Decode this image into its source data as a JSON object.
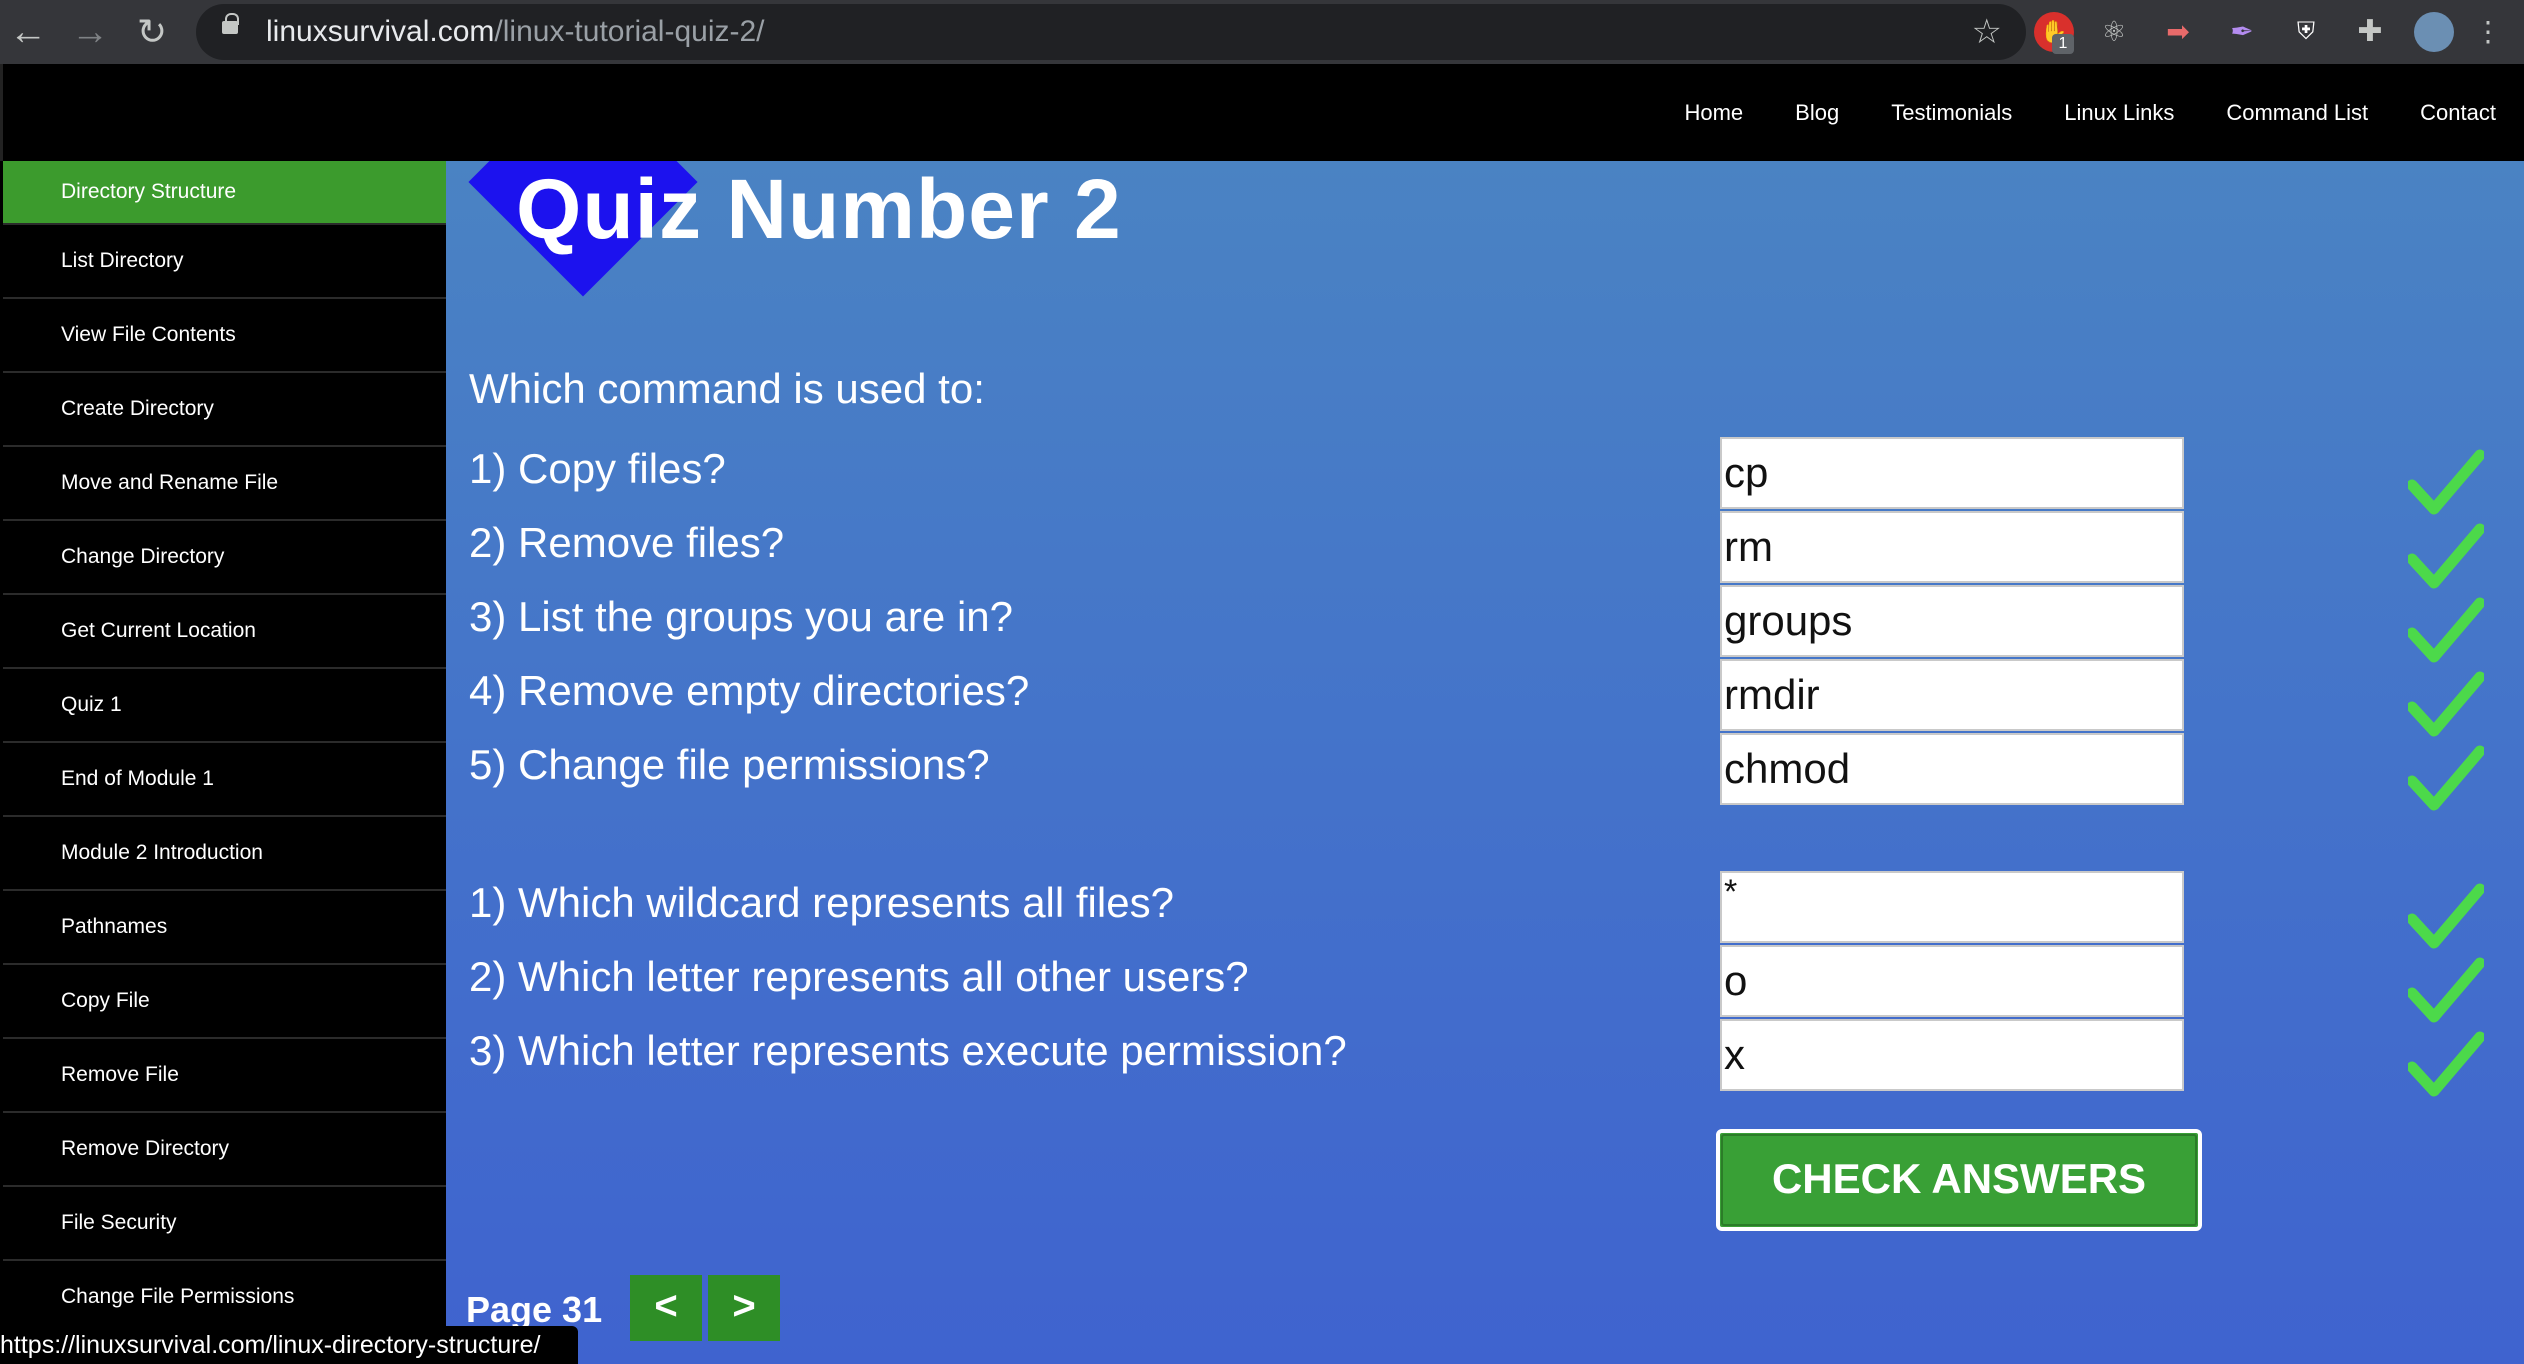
{
  "browser": {
    "url_domain": "linuxsurvival.com",
    "url_path": "/linux-tutorial-quiz-2/",
    "ext_badge": "1"
  },
  "topnav": [
    "Home",
    "Blog",
    "Testimonials",
    "Linux Links",
    "Command List",
    "Contact"
  ],
  "sidebar": [
    "Directory Structure",
    "List Directory",
    "View File Contents",
    "Create Directory",
    "Move and Rename File",
    "Change Directory",
    "Get Current Location",
    "Quiz 1",
    "End of Module 1",
    "Module 2 Introduction",
    "Pathnames",
    "Copy File",
    "Remove File",
    "Remove Directory",
    "File Security",
    "Change File Permissions"
  ],
  "main": {
    "title": "Quiz Number 2",
    "intro": "Which command is used to:",
    "questions": [
      {
        "text": "1) Copy files?",
        "answer": "cp"
      },
      {
        "text": "2) Remove files?",
        "answer": "rm"
      },
      {
        "text": "3) List the groups you are in?",
        "answer": "groups"
      },
      {
        "text": "4) Remove empty directories?",
        "answer": "rmdir"
      },
      {
        "text": "5) Change file permissions?",
        "answer": "chmod"
      },
      {
        "text": "1) Which wildcard represents all files?",
        "answer": "*"
      },
      {
        "text": "2) Which letter represents all other users?",
        "answer": "o"
      },
      {
        "text": "3) Which letter represents execute permission?",
        "answer": "x"
      }
    ],
    "check_button": "CHECK ANSWERS",
    "page_label": "Page 31",
    "prev": "<",
    "next": ">"
  },
  "status_url": "https://linuxsurvival.com/linux-directory-structure/",
  "colors": {
    "active_green": "#3c9b2d",
    "check_green": "#4cd94a",
    "diamond": "#1c12ee"
  }
}
